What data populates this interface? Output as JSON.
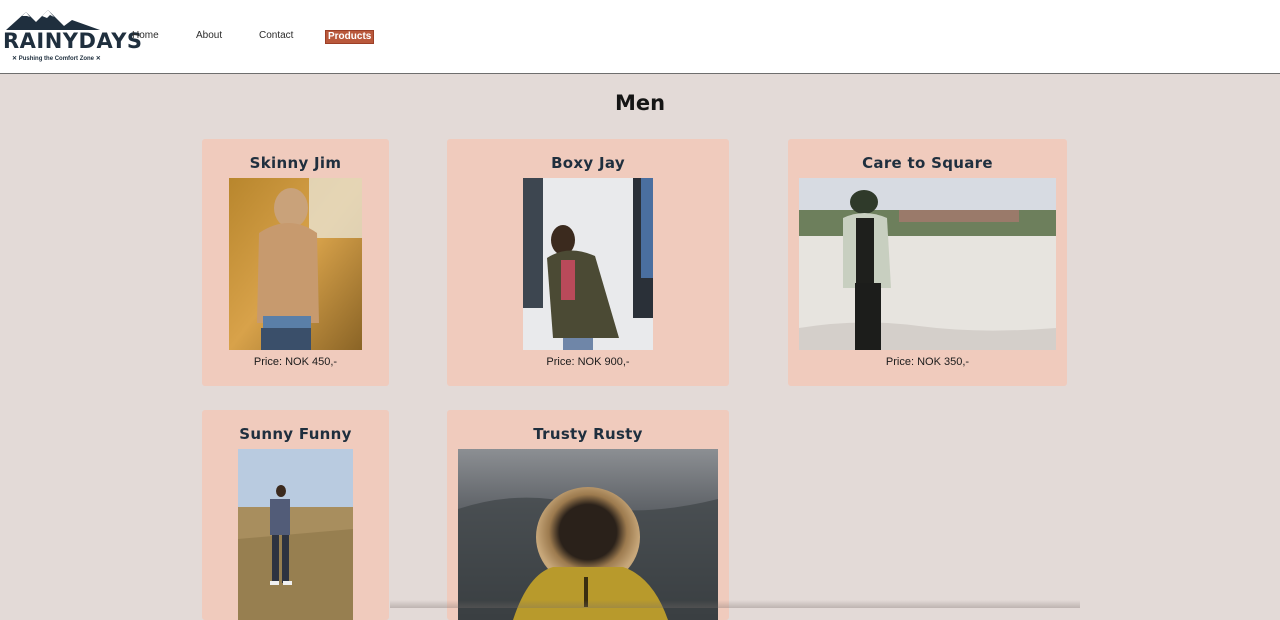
{
  "brand": {
    "name": "RAINYDAYS",
    "tagline": "✕ Pushing the Comfort Zone ✕"
  },
  "nav": {
    "items": [
      {
        "label": "Home",
        "active": false
      },
      {
        "label": "About",
        "active": false
      },
      {
        "label": "Contact",
        "active": false
      },
      {
        "label": "Products",
        "active": true
      }
    ]
  },
  "page": {
    "title": "Men"
  },
  "products": [
    {
      "name": "Skinny Jim",
      "price": "Price: NOK 450,-",
      "image": "man-in-tan-hooded-jacket-autumn-photo"
    },
    {
      "name": "Boxy Jay",
      "price": "Price: NOK 900,-",
      "image": "man-in-olive-jacket-against-white-wall-photo"
    },
    {
      "name": "Care to Square",
      "price": "Price: NOK 350,-",
      "image": "man-in-plaid-jacket-on-rooftop-photo"
    },
    {
      "name": "Sunny Funny",
      "image": "man-in-vest-standing-in-field-photo"
    },
    {
      "name": "Trusty Rusty",
      "image": "person-in-yellow-fur-hooded-parka-photo"
    }
  ],
  "colors": {
    "accent": "#b9583b",
    "card": "#f0cbbd",
    "background": "#e3dad7",
    "brand_dark": "#1f2f3e"
  }
}
